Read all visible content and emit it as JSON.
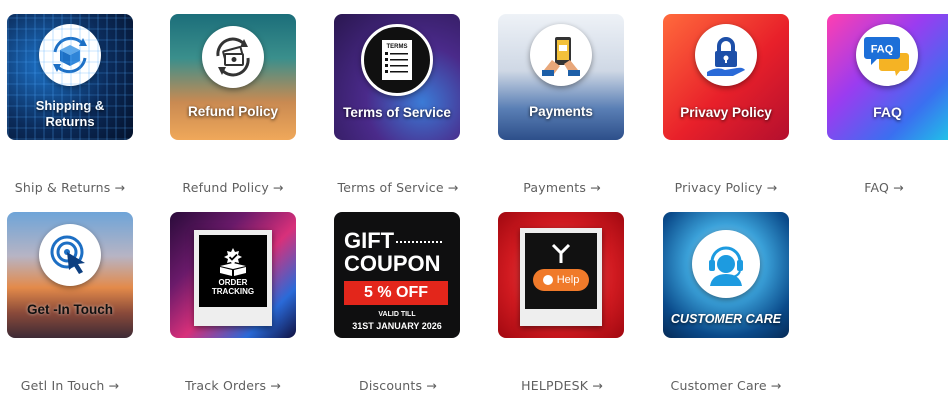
{
  "tiles": [
    {
      "overlay": "Shipping &\nReturns",
      "caption": "Ship & Returns",
      "icon": "package-return-icon"
    },
    {
      "overlay": "Refund Policy",
      "caption": "Refund Policy",
      "icon": "money-refund-icon"
    },
    {
      "overlay": "Terms of Service",
      "caption": "Terms of Service",
      "icon": "terms-document-icon",
      "doc_header": "TERMS"
    },
    {
      "overlay": "Payments",
      "caption": "Payments",
      "icon": "mobile-payment-icon"
    },
    {
      "overlay": "Privavy Policy",
      "caption": "Privacy Policy",
      "icon": "padlock-hand-icon"
    },
    {
      "overlay": "FAQ",
      "caption": "FAQ",
      "icon": "faq-chat-bubble-icon",
      "bubble_text": "FAQ"
    },
    {
      "overlay": "Get -In Touch",
      "caption": "Getl In Touch",
      "icon": "touch-tap-icon"
    },
    {
      "overlay": "ORDER\nTRACKING",
      "caption": "Track Orders",
      "icon": "order-box-check-icon"
    },
    {
      "overlay": "",
      "caption": "Discounts",
      "icon": "gift-coupon",
      "coupon": {
        "line1": "GIFT",
        "line2": "COUPON",
        "discount": "5 % OFF",
        "valid": "VALID TILL",
        "date": "31ST JANUARY 2026"
      }
    },
    {
      "overlay": "",
      "caption": "HELPDESK",
      "icon": "help-chat-icon",
      "help_text": "Help"
    },
    {
      "overlay": "CUSTOMER CARE",
      "caption": "Customer Care",
      "icon": "headset-agent-icon"
    }
  ],
  "arrow": "→",
  "colors": {
    "caption": "#5f5f5f",
    "coupon_red": "#e3261b",
    "help_orange": "#f07a2a"
  }
}
